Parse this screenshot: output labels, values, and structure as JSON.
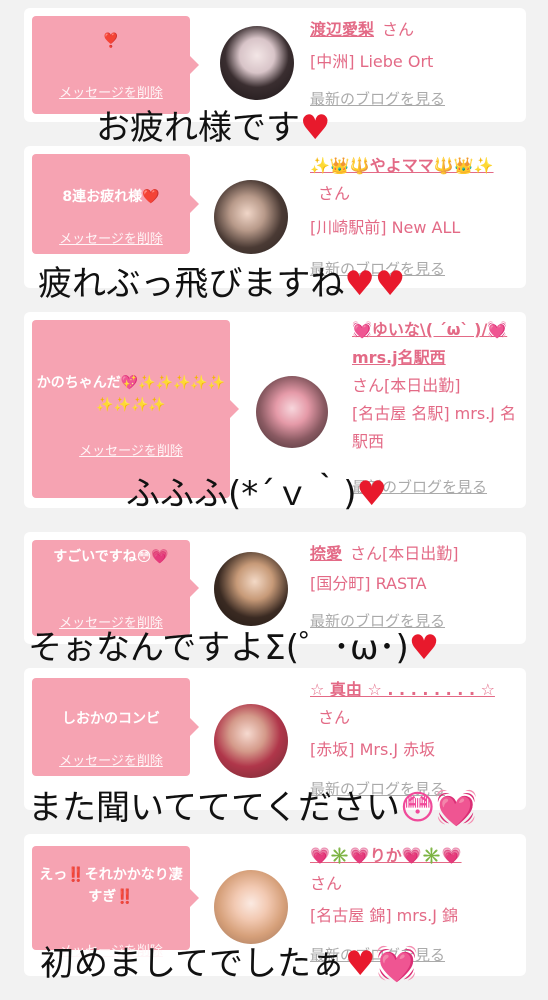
{
  "delete_label": "メッセージを削除",
  "blog_label": "最新のブログを見る",
  "san_label": "さん",
  "cards": [
    {
      "message": "❣️",
      "name": "渡辺愛梨",
      "shop": "[中洲] Liebe Ort",
      "caption": "お疲れ様です",
      "caption_emoji": "♥"
    },
    {
      "message": "8連お疲れ様❤️",
      "name": "✨👑🔱やよママ🔱👑✨",
      "shop": "[川崎駅前] New ALL",
      "caption": "疲れぶっ飛びますね",
      "caption_emoji": "♥♥"
    },
    {
      "message": "かのちゃんだ💖✨✨✨✨✨✨✨✨✨",
      "name": "💓ゆいな\\( ´ω` )/💓mrs.j名駅西",
      "san_suffix": "[本日出勤]",
      "shop": "[名古屋 名駅] mrs.J 名駅西",
      "caption": "ふふふ(*´ｖ｀)",
      "caption_emoji": "♥"
    },
    {
      "message": "すごいですね😳💗",
      "name": "捺愛",
      "san_suffix": "[本日出勤]",
      "shop": "[国分町] RASTA",
      "caption": "そぉなんですよΣ(゜･ω･)",
      "caption_emoji": "♥"
    },
    {
      "message": "しおかのコンビ",
      "name": "☆ 真由 ☆ . . . . . . . . ☆",
      "shop": "[赤坂] Mrs.J 赤坂",
      "caption": "また聞いてててください",
      "caption_emoji": "😳💓"
    },
    {
      "message": "えっ‼️それかかなり凄すぎ‼️",
      "name": "💗✳️💗りか💗✳️💗",
      "shop": "[名古屋 錦] mrs.J 錦",
      "caption": "初めましてでしたぁ",
      "caption_emoji": "♥💓"
    }
  ],
  "colors": {
    "accent": "#e36a86",
    "bubble": "#f6a3b2",
    "heart": "#e8192c",
    "background": "#f2f2f2"
  }
}
